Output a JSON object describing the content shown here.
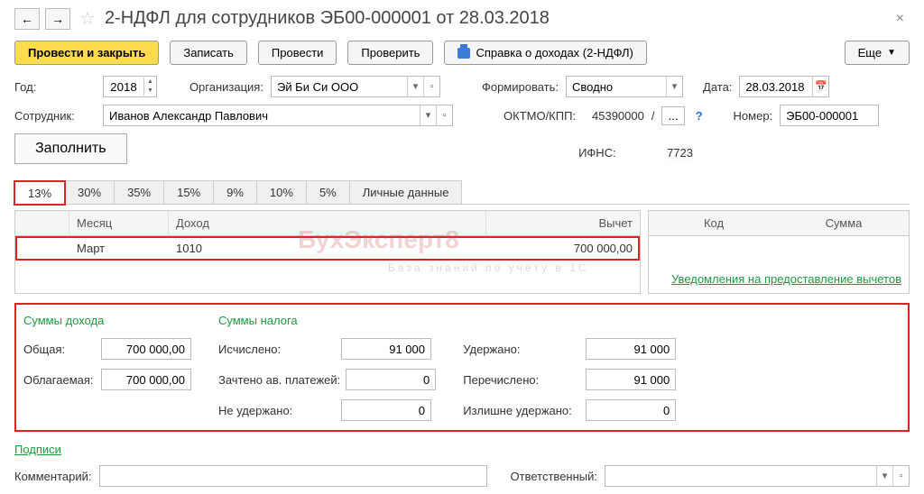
{
  "header": {
    "title": "2-НДФЛ для сотрудников ЭБ00-000001 от 28.03.2018"
  },
  "toolbar": {
    "post_close": "Провести и закрыть",
    "save": "Записать",
    "post": "Провести",
    "check": "Проверить",
    "print_ref": "Справка о доходах (2-НДФЛ)",
    "more": "Еще"
  },
  "fields": {
    "year_label": "Год:",
    "year_value": "2018",
    "org_label": "Организация:",
    "org_value": "Эй Би Си ООО",
    "form_label": "Формировать:",
    "form_value": "Сводно",
    "date_label": "Дата:",
    "date_value": "28.03.2018",
    "emp_label": "Сотрудник:",
    "emp_value": "Иванов Александр Павлович",
    "oktmo_label": "ОКТМО/КПП:",
    "oktmo_value": "45390000",
    "oktmo_sep": "/",
    "oktmo_btn": "...",
    "num_label": "Номер:",
    "num_value": "ЭБ00-000001",
    "ifns_label": "ИФНС:",
    "ifns_value": "7723",
    "fill_button": "Заполнить"
  },
  "tabs": [
    "13%",
    "30%",
    "35%",
    "15%",
    "9%",
    "10%",
    "5%",
    "Личные данные"
  ],
  "grid_left": {
    "headers": {
      "month": "Месяц",
      "income": "Доход",
      "deduction": "Вычет"
    },
    "rows": [
      {
        "month": "Март",
        "code": "1010",
        "amount": "700 000,00"
      }
    ]
  },
  "grid_right": {
    "headers": {
      "code": "Код",
      "sum": "Сумма"
    },
    "link": "Уведомления на предоставление вычетов"
  },
  "totals": {
    "income_title": "Суммы дохода",
    "tax_title": "Суммы налога",
    "total_label": "Общая:",
    "total_value": "700 000,00",
    "taxable_label": "Облагаемая:",
    "taxable_value": "700 000,00",
    "calc_label": "Исчислено:",
    "calc_value": "91 000",
    "offset_label": "Зачтено ав. платежей:",
    "offset_value": "0",
    "notheld_label": "Не удержано:",
    "notheld_value": "0",
    "held_label": "Удержано:",
    "held_value": "91 000",
    "transferred_label": "Перечислено:",
    "transferred_value": "91 000",
    "overheld_label": "Излишне удержано:",
    "overheld_value": "0"
  },
  "signatures_link": "Подписи",
  "bottom": {
    "comment_label": "Комментарий:",
    "resp_label": "Ответственный:"
  },
  "watermark": {
    "main": "БухЭксперт8",
    "sub": "База  знаний  по  учёту  в  1С"
  }
}
